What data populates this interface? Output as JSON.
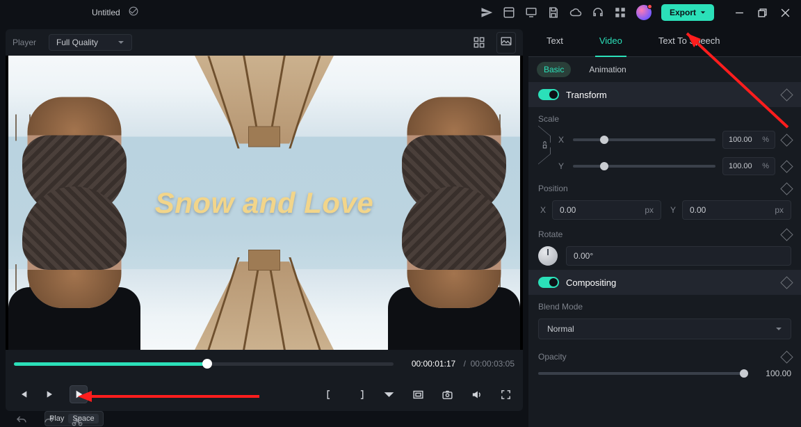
{
  "title": "Untitled",
  "export_label": "Export",
  "player": {
    "label": "Player",
    "quality": "Full Quality"
  },
  "preview": {
    "overlay_text": "Snow and Love"
  },
  "timecode": {
    "current": "00:00:01:17",
    "separator": "/",
    "total": "00:00:03:05"
  },
  "tooltip": {
    "action": "Play",
    "key": "Space"
  },
  "inspector": {
    "tabs": {
      "text": "Text",
      "video": "Video",
      "tts": "Text To Speech"
    },
    "subtabs": {
      "basic": "Basic",
      "animation": "Animation"
    },
    "transform": {
      "title": "Transform",
      "scale_label": "Scale",
      "scale_x": "100.00",
      "scale_y": "100.00",
      "scale_unit": "%",
      "position_label": "Position",
      "pos_x": "0.00",
      "pos_y": "0.00",
      "pos_unit": "px",
      "rotate_label": "Rotate",
      "rotate_val": "0.00°"
    },
    "compositing": {
      "title": "Compositing",
      "blend_label": "Blend Mode",
      "blend_value": "Normal",
      "opacity_label": "Opacity",
      "opacity_value": "100.00"
    }
  },
  "axes": {
    "x": "X",
    "y": "Y"
  }
}
